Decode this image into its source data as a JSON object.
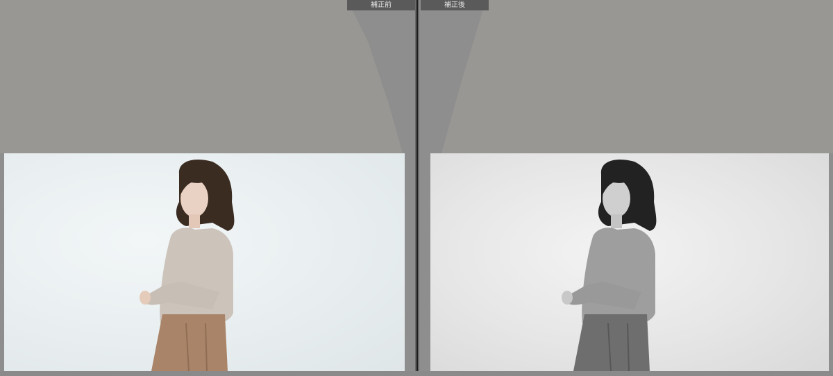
{
  "compare_view": {
    "before_label": "補正前",
    "after_label": "補正後"
  },
  "colors": {
    "panel_bg": "#8e8e8e",
    "tab_bg": "#5a5a5a",
    "tab_text": "#e2e2e2",
    "divider": "#1c1c1c"
  }
}
